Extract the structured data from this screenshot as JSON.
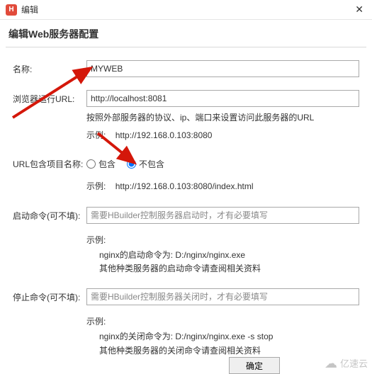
{
  "titlebar": {
    "title": "编辑",
    "app_icon_letter": "H"
  },
  "header": {
    "title": "编辑Web服务器配置"
  },
  "fields": {
    "name": {
      "label": "名称:",
      "value": "MYWEB"
    },
    "url": {
      "label": "浏览器运行URL:",
      "value": "http://localhost:8081",
      "hint1": "按照外部服务器的协议、ip、端口来设置访问此服务器的URL",
      "example_label": "示例:",
      "example_value": "http://192.168.0.103:8080"
    },
    "includeProject": {
      "label": "URL包含项目名称:",
      "opt_include": "包含",
      "opt_exclude": "不包含",
      "selected": "exclude",
      "example_label": "示例:",
      "example_value": "http://192.168.0.103:8080/index.html"
    },
    "startCmd": {
      "label": "启动命令(可不填):",
      "placeholder": "需要HBuilder控制服务器启动时，才有必要填写",
      "example_label": "示例:",
      "example_line1": "nginx的启动命令为:  D:/nginx/nginx.exe",
      "example_line2": "其他种类服务器的启动命令请查阅相关资料"
    },
    "stopCmd": {
      "label": "停止命令(可不填):",
      "placeholder": "需要HBuilder控制服务器关闭时，才有必要填写",
      "example_label": "示例:",
      "example_line1": "nginx的关闭命令为:  D:/nginx/nginx.exe -s stop",
      "example_line2": "其他种类服务器的关闭命令请查阅相关资料"
    }
  },
  "buttons": {
    "ok": "确定"
  },
  "watermark": {
    "text": "亿速云"
  }
}
